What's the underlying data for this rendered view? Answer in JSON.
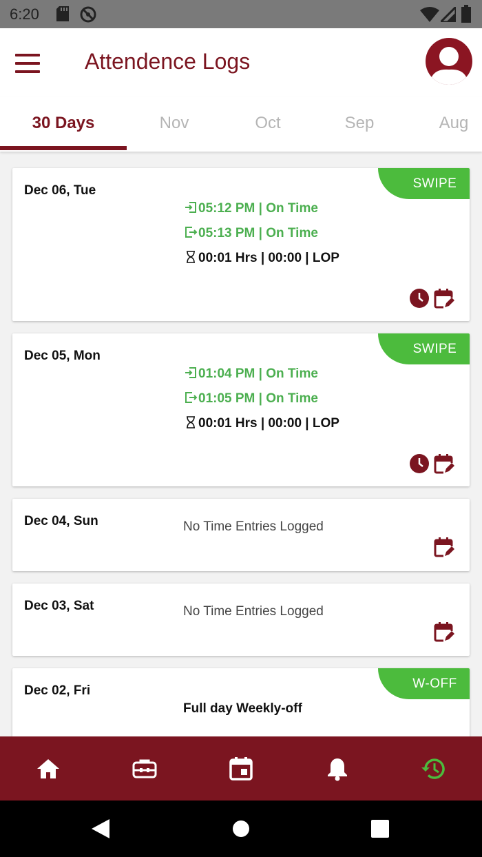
{
  "status_bar": {
    "time": "6:20",
    "icons": [
      "sd-card-icon",
      "no-sync-icon",
      "wifi-icon",
      "signal-icon",
      "battery-icon"
    ]
  },
  "header": {
    "title": "Attendence Logs",
    "menu_icon": "menu-icon",
    "avatar_icon": "user-avatar-icon"
  },
  "tabs": [
    {
      "label": "30 Days",
      "active": true
    },
    {
      "label": "Nov",
      "active": false
    },
    {
      "label": "Oct",
      "active": false
    },
    {
      "label": "Sep",
      "active": false
    },
    {
      "label": "Aug",
      "active": false
    }
  ],
  "logs": [
    {
      "date": "Dec 06, Tue",
      "badge": "SWIPE",
      "in": "05:12 PM | On Time",
      "out": "05:13 PM | On Time",
      "duration": "00:01 Hrs |  00:00  | LOP"
    },
    {
      "date": "Dec 05, Mon",
      "badge": "SWIPE",
      "in": "01:04 PM | On Time",
      "out": "01:05 PM | On Time",
      "duration": "00:01 Hrs |  00:00  | LOP"
    },
    {
      "date": "Dec 04, Sun",
      "message": "No Time Entries Logged"
    },
    {
      "date": "Dec 03, Sat",
      "message": "No Time Entries Logged"
    },
    {
      "date": "Dec 02, Fri",
      "badge": "W-OFF",
      "message": "Full day Weekly-off"
    }
  ],
  "bottom_nav": [
    {
      "icon": "home-icon",
      "active": false
    },
    {
      "icon": "briefcase-icon",
      "active": false
    },
    {
      "icon": "calendar-icon",
      "active": false
    },
    {
      "icon": "bell-icon",
      "active": false
    },
    {
      "icon": "history-icon",
      "active": true
    }
  ],
  "colors": {
    "brand": "#7b1520",
    "accent_green": "#4cbb3d",
    "text_green": "#4caf50"
  }
}
